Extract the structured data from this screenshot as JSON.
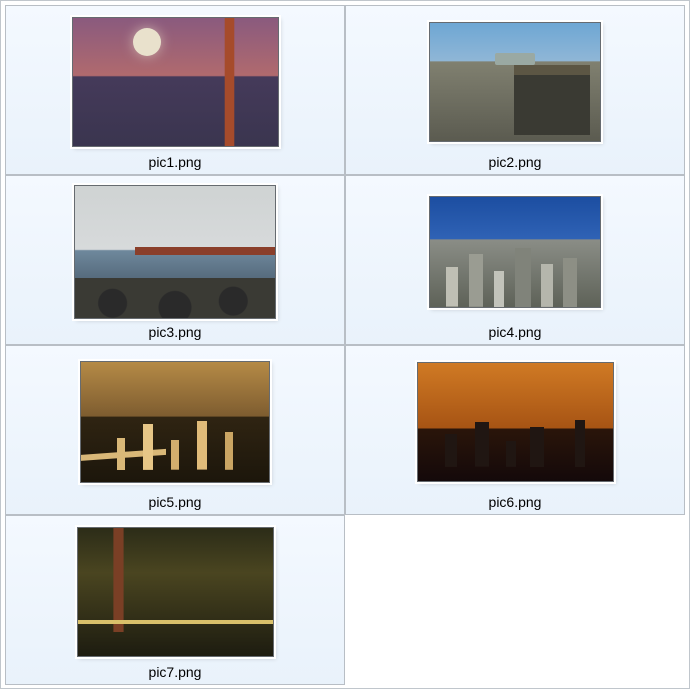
{
  "items": [
    {
      "filename": "pic1.png",
      "thumbClass": "img-pic1"
    },
    {
      "filename": "pic2.png",
      "thumbClass": "img-pic2"
    },
    {
      "filename": "pic3.png",
      "thumbClass": "img-pic3"
    },
    {
      "filename": "pic4.png",
      "thumbClass": "img-pic4"
    },
    {
      "filename": "pic5.png",
      "thumbClass": "img-pic5"
    },
    {
      "filename": "pic6.png",
      "thumbClass": "img-pic6"
    },
    {
      "filename": "pic7.png",
      "thumbClass": "img-pic7"
    }
  ]
}
